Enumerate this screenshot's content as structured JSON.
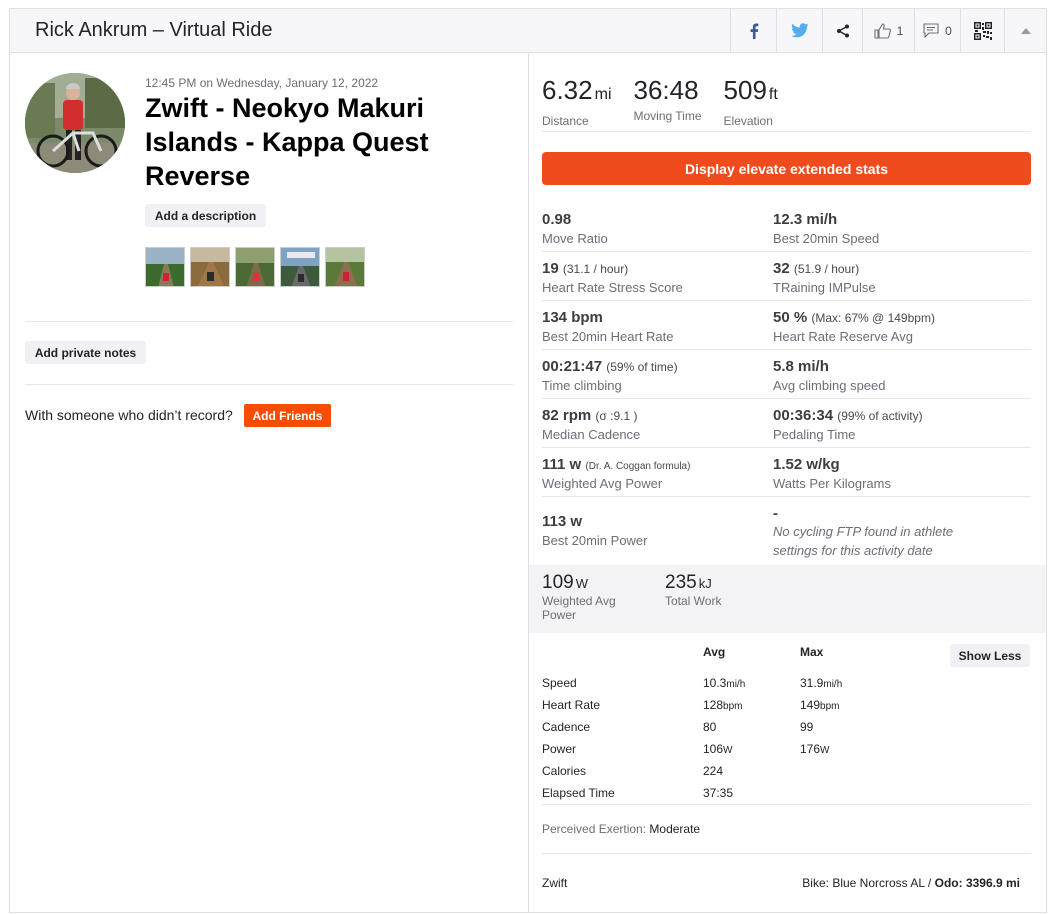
{
  "header": {
    "title": "Rick Ankrum – Virtual Ride",
    "kudos_count": "1",
    "comment_count": "0"
  },
  "activity": {
    "time": "12:45 PM",
    "date_prefix": "on",
    "date": "Wednesday, January 12, 2022",
    "title": "Zwift - Neokyo Makuri Islands - Kappa Quest Reverse",
    "add_description_label": "Add a description",
    "add_private_notes_label": "Add private notes",
    "with_someone_text": "With someone who didn’t record?",
    "add_friends_label": "Add Friends"
  },
  "summary": [
    {
      "value": "6.32",
      "unit": "mi",
      "label": "Distance"
    },
    {
      "value": "36:48",
      "unit": "",
      "label": "Moving Time"
    },
    {
      "value": "509",
      "unit": "ft",
      "label": "Elevation"
    }
  ],
  "elevate_button_label": "Display elevate extended stats",
  "extended_stats": {
    "move_ratio": {
      "value": "0.98",
      "extra": "",
      "label": "Move Ratio"
    },
    "best_20min_speed": {
      "value": "12.3 mi/h",
      "extra": "",
      "label": "Best 20min Speed"
    },
    "hrss": {
      "value": "19",
      "extra": "(31.1 / hour)",
      "label": "Heart Rate Stress Score"
    },
    "trimp": {
      "value": "32",
      "extra": "(51.9 / hour)",
      "label": "TRaining IMPulse"
    },
    "best_20min_hr": {
      "value": "134 bpm",
      "extra": "",
      "label": "Best 20min Heart Rate"
    },
    "hrr_avg": {
      "value": "50 %",
      "extra": "(Max: 67% @ 149bpm)",
      "label": "Heart Rate Reserve Avg"
    },
    "time_climbing": {
      "value": "00:21:47",
      "extra": "(59% of time)",
      "label": "Time climbing"
    },
    "avg_climbing_speed": {
      "value": "5.8 mi/h",
      "extra": "",
      "label": "Avg climbing speed"
    },
    "median_cadence": {
      "value": "82 rpm",
      "extra": "(σ :9.1 )",
      "label": "Median Cadence"
    },
    "pedaling_time": {
      "value": "00:36:34",
      "extra": "(99% of activity)",
      "label": "Pedaling Time"
    },
    "weighted_avg_power": {
      "value": "111 w",
      "extra": "(Dr. A. Coggan formula)",
      "label": "Weighted Avg Power"
    },
    "watts_per_kg": {
      "value": "1.52 w/kg",
      "extra": "",
      "label": "Watts Per Kilograms"
    },
    "best_20min_power": {
      "value": "113 w",
      "extra": "",
      "label": "Best 20min Power"
    },
    "ftp": {
      "value": "-",
      "note_line1": "No cycling FTP found in athlete",
      "note_line2": "settings for this activity date"
    }
  },
  "secondary": [
    {
      "value": "109",
      "unit": "W",
      "label_line1": "Weighted Avg",
      "label_line2": "Power"
    },
    {
      "value": "235",
      "unit": "kJ",
      "label_line1": "Total Work",
      "label_line2": ""
    }
  ],
  "more_stats": {
    "col_avg": "Avg",
    "col_max": "Max",
    "show_less_label": "Show Less",
    "rows": [
      {
        "label": "Speed",
        "avg": "10.3",
        "avg_unit": "mi/h",
        "max": "31.9",
        "max_unit": "mi/h"
      },
      {
        "label": "Heart Rate",
        "avg": "128",
        "avg_unit": "bpm",
        "max": "149",
        "max_unit": "bpm"
      },
      {
        "label": "Cadence",
        "avg": "80",
        "avg_unit": "",
        "max": "99",
        "max_unit": ""
      },
      {
        "label": "Power",
        "avg": "106",
        "avg_unit": "W",
        "max": "176",
        "max_unit": "W"
      },
      {
        "label": "Calories",
        "avg": "224",
        "avg_unit": "",
        "max": "",
        "max_unit": ""
      },
      {
        "label": "Elapsed Time",
        "avg": "37:35",
        "avg_unit": "",
        "max": "",
        "max_unit": ""
      }
    ]
  },
  "perceived": {
    "label": "Perceived Exertion:",
    "value": "Moderate"
  },
  "footer": {
    "device": "Zwift",
    "bike_label": "Bike:",
    "bike_name": "Blue Norcross AL",
    "separator": "/",
    "odo_label": "Odo:",
    "odo_value": "3396.9 mi"
  }
}
